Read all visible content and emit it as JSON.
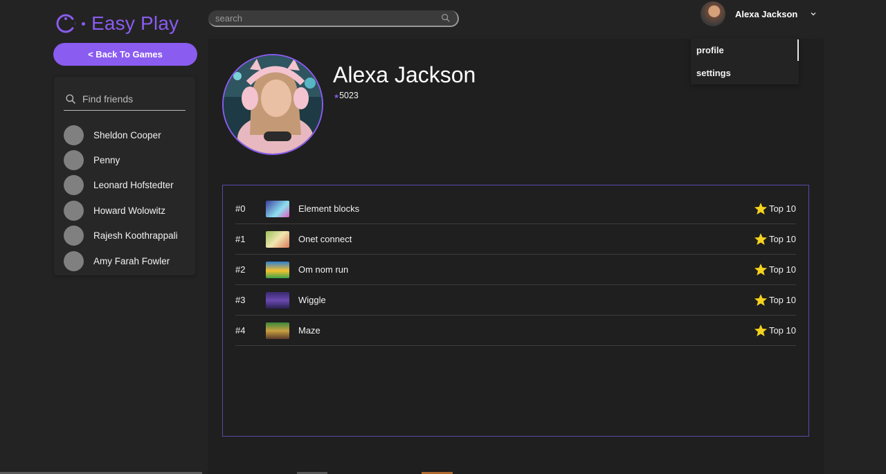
{
  "brand": {
    "name": "Easy Play",
    "accent": "#8a5cf0"
  },
  "sidebar": {
    "back_label": "< Back To Games",
    "search_placeholder": "Find friends",
    "friends": [
      {
        "name": "Sheldon Cooper"
      },
      {
        "name": "Penny"
      },
      {
        "name": "Leonard Hofstedter"
      },
      {
        "name": "Howard Wolowitz"
      },
      {
        "name": "Rajesh Koothrappali"
      },
      {
        "name": "Amy Farah Fowler"
      }
    ]
  },
  "topbar": {
    "search_placeholder": "search",
    "user_name": "Alexa Jackson"
  },
  "dropdown": {
    "items": [
      {
        "label": "profile"
      },
      {
        "label": "settings"
      }
    ]
  },
  "profile": {
    "name": "Alexa Jackson",
    "score": "5023"
  },
  "games": [
    {
      "rank": "#0",
      "title": "Element blocks",
      "badge": "Top 10",
      "thumb_color": "#3a3fa0"
    },
    {
      "rank": "#1",
      "title": "Onet connect",
      "badge": "Top 10",
      "thumb_color": "#9bc25a"
    },
    {
      "rank": "#2",
      "title": "Om nom run",
      "badge": "Top 10",
      "thumb_color": "#2f7fd1"
    },
    {
      "rank": "#3",
      "title": "Wiggle",
      "badge": "Top 10",
      "thumb_color": "#3a2a6e"
    },
    {
      "rank": "#4",
      "title": "Maze",
      "badge": "Top 10",
      "thumb_color": "#3c8a3a"
    }
  ]
}
